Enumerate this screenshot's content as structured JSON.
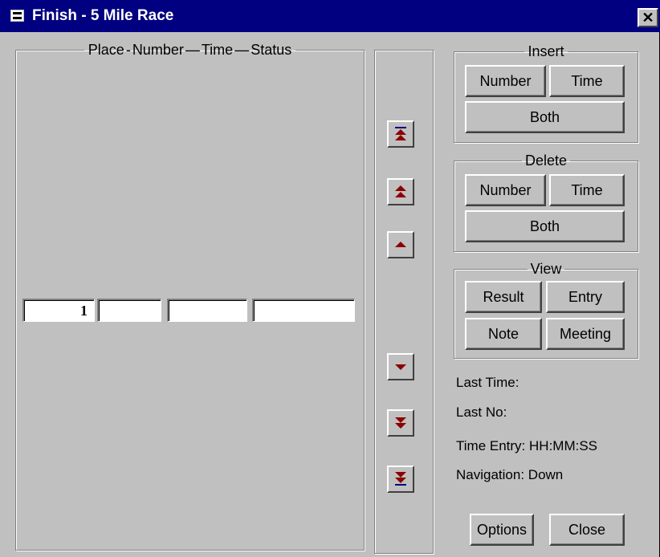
{
  "window": {
    "title": "Finish - 5 Mile Race",
    "title_icon": "form-icon",
    "close_label": "✕"
  },
  "grid": {
    "headers": [
      "Place",
      "Number",
      "Time",
      "Status"
    ],
    "row": {
      "place": "1",
      "number": "",
      "time": "",
      "status": ""
    }
  },
  "navigation_buttons": [
    {
      "name": "nav-first-button",
      "icon": "first-record-icon"
    },
    {
      "name": "nav-page-up-button",
      "icon": "page-up-icon"
    },
    {
      "name": "nav-prev-button",
      "icon": "previous-record-icon"
    },
    {
      "name": "nav-next-button",
      "icon": "next-record-icon"
    },
    {
      "name": "nav-page-down-button",
      "icon": "page-down-icon"
    },
    {
      "name": "nav-last-button",
      "icon": "last-record-icon"
    }
  ],
  "insert": {
    "title": "Insert",
    "number_label": "Number",
    "time_label": "Time",
    "both_label": "Both"
  },
  "delete": {
    "title": "Delete",
    "number_label": "Number",
    "time_label": "Time",
    "both_label": "Both"
  },
  "view": {
    "title": "View",
    "result_label": "Result",
    "entry_label": "Entry",
    "note_label": "Note",
    "meeting_label": "Meeting"
  },
  "info": {
    "last_time_label": "Last Time:",
    "last_no_label": "Last No:",
    "time_entry_label": "Time Entry:",
    "time_entry_value": "HH:MM:SS",
    "navigation_label": "Navigation:",
    "navigation_value": "Down"
  },
  "footer": {
    "options_label": "Options",
    "close_label": "Close"
  },
  "colors": {
    "titlebar": "#000080",
    "face": "#c0c0c0",
    "arrow": "#8b0000",
    "arrow_bar": "#000080"
  }
}
